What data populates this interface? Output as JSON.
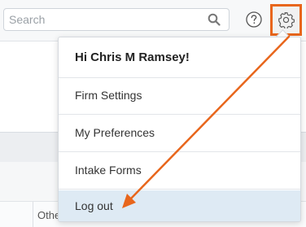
{
  "search": {
    "placeholder": "Search"
  },
  "background": {
    "cell_text": "Othe"
  },
  "menu": {
    "greeting": "Hi Chris M Ramsey!",
    "items": [
      {
        "label": "Firm Settings"
      },
      {
        "label": "My Preferences"
      },
      {
        "label": "Intake Forms"
      },
      {
        "label": "Log out"
      }
    ]
  },
  "colors": {
    "annotation": "#e8661c",
    "highlight": "#deeaf4"
  },
  "icons": {
    "search": "search-icon",
    "help": "help-icon",
    "settings": "gear-icon"
  }
}
